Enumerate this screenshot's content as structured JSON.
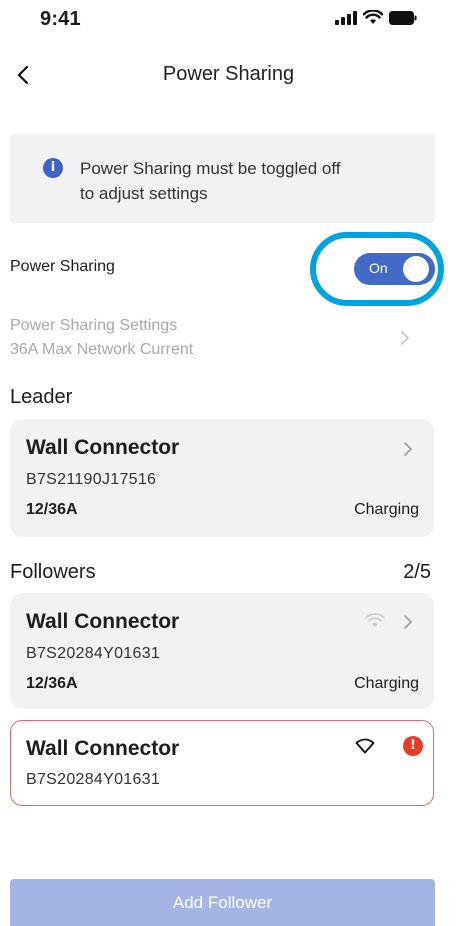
{
  "status_bar": {
    "time": "9:41"
  },
  "header": {
    "title": "Power Sharing"
  },
  "banner": {
    "icon_glyph": "i",
    "text_line1": "Power Sharing must be toggled off",
    "text_line2": "to adjust settings"
  },
  "power_sharing": {
    "label": "Power Sharing",
    "toggle_label": "On",
    "toggle_on": true
  },
  "settings": {
    "line1": "Power Sharing Settings",
    "line2": "36A Max Network Current"
  },
  "leader": {
    "heading": "Leader",
    "card": {
      "title": "Wall Connector",
      "serial": "B7S21190J17516",
      "current": "12/36A",
      "status": "Charging"
    }
  },
  "followers": {
    "heading": "Followers",
    "count": "2/5",
    "cards": [
      {
        "title": "Wall Connector",
        "serial": "B7S20284Y01631",
        "current": "12/36A",
        "status": "Charging"
      },
      {
        "title": "Wall Connector",
        "serial": "B7S20284Y01631",
        "alert_glyph": "!"
      }
    ]
  },
  "footer": {
    "add_button_label": "Add Follower"
  },
  "colors": {
    "accent": "#4169c5",
    "highlight_ring": "#00a3dc",
    "error": "#e53c2c",
    "button_disabled": "#a4b4e4"
  }
}
